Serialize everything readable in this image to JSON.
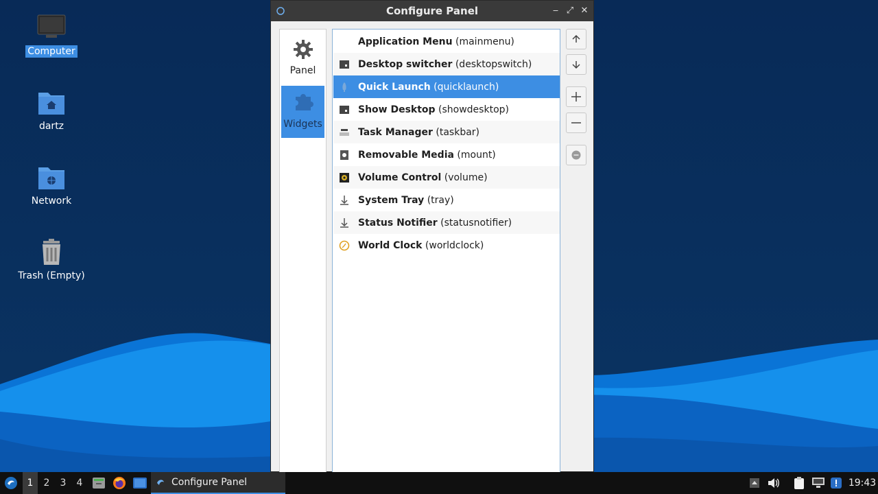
{
  "desktop": {
    "icons": [
      {
        "label": "Computer",
        "icon": "computer-icon",
        "selected": true
      },
      {
        "label": "dartz",
        "icon": "home-folder-icon"
      },
      {
        "label": "Network",
        "icon": "network-folder-icon"
      },
      {
        "label": "Trash (Empty)",
        "icon": "trash-icon"
      }
    ]
  },
  "window": {
    "title": "Configure Panel",
    "controls": {
      "minimize": "‒",
      "maximize": "⤢",
      "close": "✕"
    },
    "sidebar": [
      {
        "label": "Panel",
        "icon": "gear-icon"
      },
      {
        "label": "Widgets",
        "icon": "puzzle-icon",
        "active": true
      }
    ],
    "plugins": [
      {
        "name": "Application Menu",
        "id": " (mainmenu)",
        "icon": "blank-icon"
      },
      {
        "name": "Desktop switcher",
        "id": " (desktopswitch)",
        "icon": "desktop-switch-icon"
      },
      {
        "name": "Quick Launch",
        "id": " (quicklaunch)",
        "icon": "rocket-icon",
        "selected": true
      },
      {
        "name": "Show Desktop",
        "id": " (showdesktop)",
        "icon": "show-desktop-icon"
      },
      {
        "name": "Task Manager",
        "id": " (taskbar)",
        "icon": "task-manager-icon"
      },
      {
        "name": "Removable Media",
        "id": " (mount)",
        "icon": "removable-media-icon"
      },
      {
        "name": "Volume Control",
        "id": " (volume)",
        "icon": "volume-icon"
      },
      {
        "name": "System Tray",
        "id": " (tray)",
        "icon": "tray-arrow-icon"
      },
      {
        "name": "Status Notifier",
        "id": " (statusnotifier)",
        "icon": "tray-arrow-icon"
      },
      {
        "name": "World Clock",
        "id": " (worldclock)",
        "icon": "clock-icon"
      }
    ],
    "buttons": [
      "move-up",
      "move-down",
      "add",
      "remove",
      "configure"
    ]
  },
  "taskbar": {
    "desktops": [
      "1",
      "2",
      "3",
      "4"
    ],
    "active_desktop": "1",
    "task_title": "Configure Panel",
    "clock": "19:43"
  },
  "colors": {
    "accent": "#3d8ee3",
    "titlebar": "#3a3a3a",
    "desktop_bg": "#0b2d5a"
  }
}
